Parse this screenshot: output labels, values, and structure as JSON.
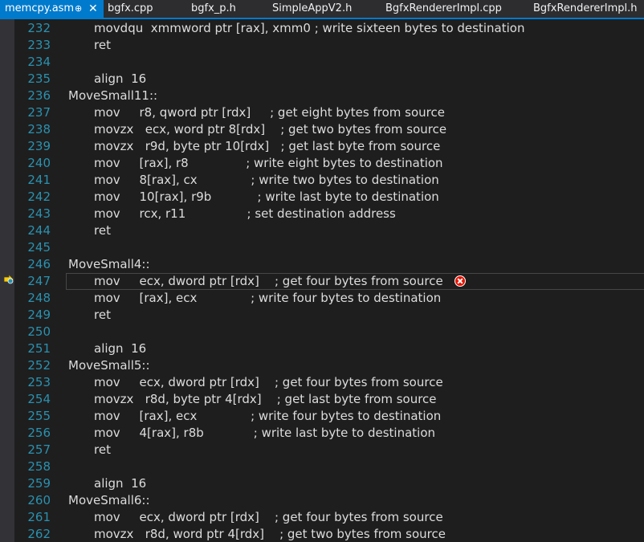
{
  "tabs": [
    {
      "label": "memcpy.asm",
      "active": true,
      "pin": "⊕",
      "close": "✕"
    },
    {
      "label": "bgfx.cpp"
    },
    {
      "label": "bgfx_p.h"
    },
    {
      "label": "SimpleAppV2.h"
    },
    {
      "label": "BgfxRendererImpl.cpp"
    },
    {
      "label": "BgfxRendererImpl.h"
    }
  ],
  "editor": {
    "current_line": "247",
    "lines": [
      {
        "num": "232",
        "code": "movdqu  xmmword ptr [rax], xmm0 ; write sixteen bytes to destination"
      },
      {
        "num": "233",
        "code": "ret"
      },
      {
        "num": "234",
        "code": ""
      },
      {
        "num": "235",
        "code": "align  16"
      },
      {
        "num": "236",
        "code": "MoveSmall11::"
      },
      {
        "num": "237",
        "code": "mov     r8, qword ptr [rdx]     ; get eight bytes from source"
      },
      {
        "num": "238",
        "code": "movzx   ecx, word ptr 8[rdx]    ; get two bytes from source"
      },
      {
        "num": "239",
        "code": "movzx   r9d, byte ptr 10[rdx]   ; get last byte from source"
      },
      {
        "num": "240",
        "code": "mov     [rax], r8               ; write eight bytes to destination"
      },
      {
        "num": "241",
        "code": "mov     8[rax], cx              ; write two bytes to destination"
      },
      {
        "num": "242",
        "code": "mov     10[rax], r9b            ; write last byte to destination"
      },
      {
        "num": "243",
        "code": "mov     rcx, r11                ; set destination address"
      },
      {
        "num": "244",
        "code": "ret"
      },
      {
        "num": "245",
        "code": ""
      },
      {
        "num": "246",
        "code": "MoveSmall4::"
      },
      {
        "num": "247",
        "code": "mov     ecx, dword ptr [rdx]    ; get four bytes from source"
      },
      {
        "num": "248",
        "code": "mov     [rax], ecx              ; write four bytes to destination"
      },
      {
        "num": "249",
        "code": "ret"
      },
      {
        "num": "250",
        "code": ""
      },
      {
        "num": "251",
        "code": "align  16"
      },
      {
        "num": "252",
        "code": "MoveSmall5::"
      },
      {
        "num": "253",
        "code": "mov     ecx, dword ptr [rdx]    ; get four bytes from source"
      },
      {
        "num": "254",
        "code": "movzx   r8d, byte ptr 4[rdx]    ; get last byte from source"
      },
      {
        "num": "255",
        "code": "mov     [rax], ecx              ; write four bytes to destination"
      },
      {
        "num": "256",
        "code": "mov     4[rax], r8b             ; write last byte to destination"
      },
      {
        "num": "257",
        "code": "ret"
      },
      {
        "num": "258",
        "code": ""
      },
      {
        "num": "259",
        "code": "align  16"
      },
      {
        "num": "260",
        "code": "MoveSmall6::"
      },
      {
        "num": "261",
        "code": "mov     ecx, dword ptr [rdx]    ; get four bytes from source"
      },
      {
        "num": "262",
        "code": "movzx   r8d, word ptr 4[rdx]    ; get two bytes from source"
      }
    ]
  },
  "icons": {
    "breakpoint_arrow": "current-statement-arrow-icon",
    "error": "error-icon"
  },
  "colors": {
    "accent": "#007acc",
    "line_number": "#2b91af",
    "text": "#dcdcdc",
    "error": "#e51400"
  }
}
